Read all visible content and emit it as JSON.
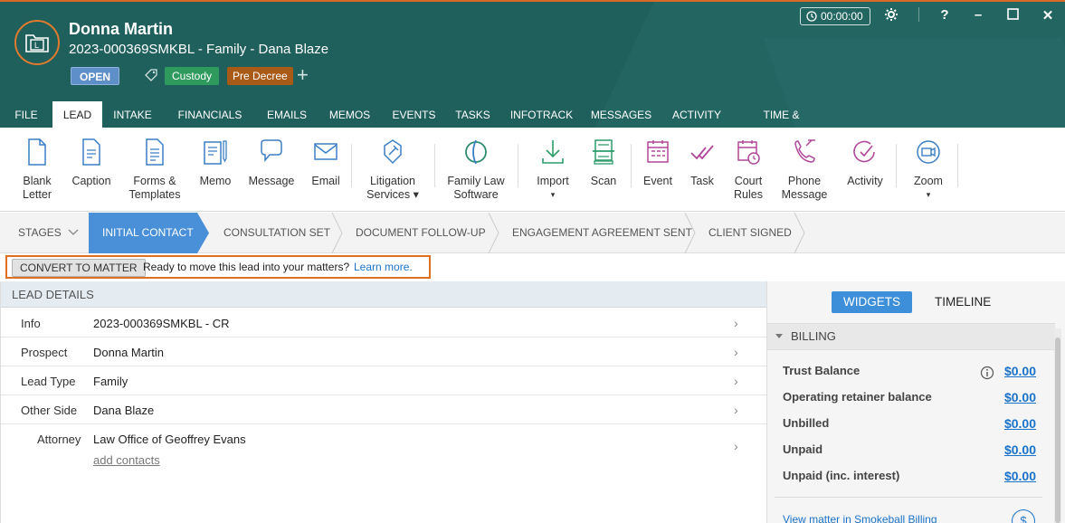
{
  "header": {
    "client_name": "Donna Martin",
    "matter_line": "2023-000369SMKBL - Family - Dana Blaze",
    "status_badge": "OPEN",
    "tags": [
      "Custody",
      "Pre Decree"
    ],
    "timer": "00:00:00",
    "tag_colors": {
      "custody": "#2f9a5d",
      "pre_decree": "#a85a16"
    }
  },
  "window_controls": {
    "help": "?",
    "minimize": "–",
    "close": "✕"
  },
  "tabs": [
    "FILE",
    "LEAD",
    "INTAKE",
    "FINANCIALS",
    "EMAILS",
    "MEMOS",
    "EVENTS",
    "TASKS",
    "INFOTRACK",
    "MESSAGES",
    "ACTIVITY",
    "TIME & EXPENSES"
  ],
  "ribbon": {
    "blank_letter": [
      "Blank",
      "Letter"
    ],
    "caption": "Caption",
    "forms": [
      "Forms &",
      "Templates"
    ],
    "memo": "Memo",
    "message": "Message",
    "email": "Email",
    "litigation": [
      "Litigation",
      "Services"
    ],
    "family_law": [
      "Family Law",
      "Software"
    ],
    "import": "Import",
    "scan": "Scan",
    "event": "Event",
    "task": "Task",
    "court_rules": [
      "Court",
      "Rules"
    ],
    "phone_message": [
      "Phone",
      "Message"
    ],
    "activity": "Activity",
    "zoom": "Zoom"
  },
  "stages": {
    "label": "STAGES",
    "items": [
      "INITIAL CONTACT",
      "CONSULTATION SET",
      "DOCUMENT FOLLOW-UP",
      "ENGAGEMENT AGREEMENT SENT",
      "CLIENT SIGNED"
    ]
  },
  "convert": {
    "button": "CONVERT TO MATTER",
    "text": "Ready to move this lead into your matters?",
    "link": "Learn more."
  },
  "lead_details": {
    "title": "LEAD DETAILS",
    "rows": [
      {
        "label": "Info",
        "value": "2023-000369SMKBL - CR"
      },
      {
        "label": "Prospect",
        "value": "Donna Martin"
      },
      {
        "label": "Lead Type",
        "value": "Family"
      },
      {
        "label": "Other Side",
        "value": "Dana Blaze"
      },
      {
        "label": "Attorney",
        "value": "Law Office of Geoffrey Evans"
      }
    ],
    "add_contacts": "add contacts"
  },
  "right_panel": {
    "widgets": "WIDGETS",
    "timeline": "TIMELINE",
    "billing_title": "BILLING",
    "billing": [
      {
        "label": "Trust Balance",
        "value": "$0.00"
      },
      {
        "label": "Operating retainer balance",
        "value": "$0.00"
      },
      {
        "label": "Unbilled",
        "value": "$0.00"
      },
      {
        "label": "Unpaid",
        "value": "$0.00"
      },
      {
        "label": "Unpaid (inc. interest)",
        "value": "$0.00"
      }
    ],
    "view_link": "View matter in Smokeball Billing",
    "dollar_symbol": "$"
  },
  "colors": {
    "header_bg": "#1f5f5c",
    "accent_orange": "#e0701f",
    "active_stage": "#4a90d9",
    "link_blue": "#1a73c9"
  }
}
